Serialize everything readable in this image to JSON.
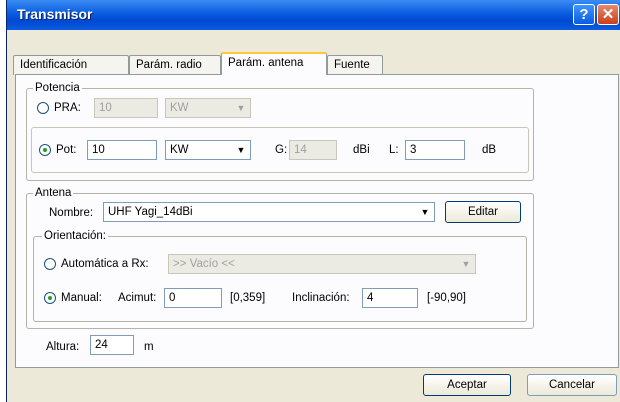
{
  "window": {
    "title": "Transmisor",
    "help_label": "?",
    "close_label": "✕"
  },
  "tabs": [
    {
      "label": "Identificación"
    },
    {
      "label": "Parám. radio"
    },
    {
      "label": "Parám. antena"
    },
    {
      "label": "Fuente"
    }
  ],
  "potencia": {
    "legend": "Potencia",
    "pra_label": "PRA:",
    "pra_value": "10",
    "pra_unit": "KW",
    "pot_label": "Pot:",
    "pot_value": "10",
    "pot_unit": "KW",
    "g_label": "G:",
    "g_value": "14",
    "g_unit": "dBi",
    "l_label": "L:",
    "l_value": "3",
    "l_unit": "dB"
  },
  "antena": {
    "legend": "Antena",
    "nombre_label": "Nombre:",
    "nombre_value": "UHF Yagi_14dBi",
    "editar_label": "Editar",
    "orientacion": {
      "legend": "Orientación:",
      "auto_label": "Automática a Rx:",
      "auto_value": ">> Vacío <<",
      "manual_label": "Manual:",
      "acimut_label": "Acimut:",
      "acimut_value": "0",
      "acimut_range": "[0,359]",
      "inclinacion_label": "Inclinación:",
      "inclinacion_value": "4",
      "inclinacion_range": "[-90,90]"
    }
  },
  "altura": {
    "label": "Altura:",
    "value": "24",
    "unit": "m"
  },
  "footer": {
    "aceptar_label": "Aceptar",
    "cancelar_label": "Cancelar"
  }
}
